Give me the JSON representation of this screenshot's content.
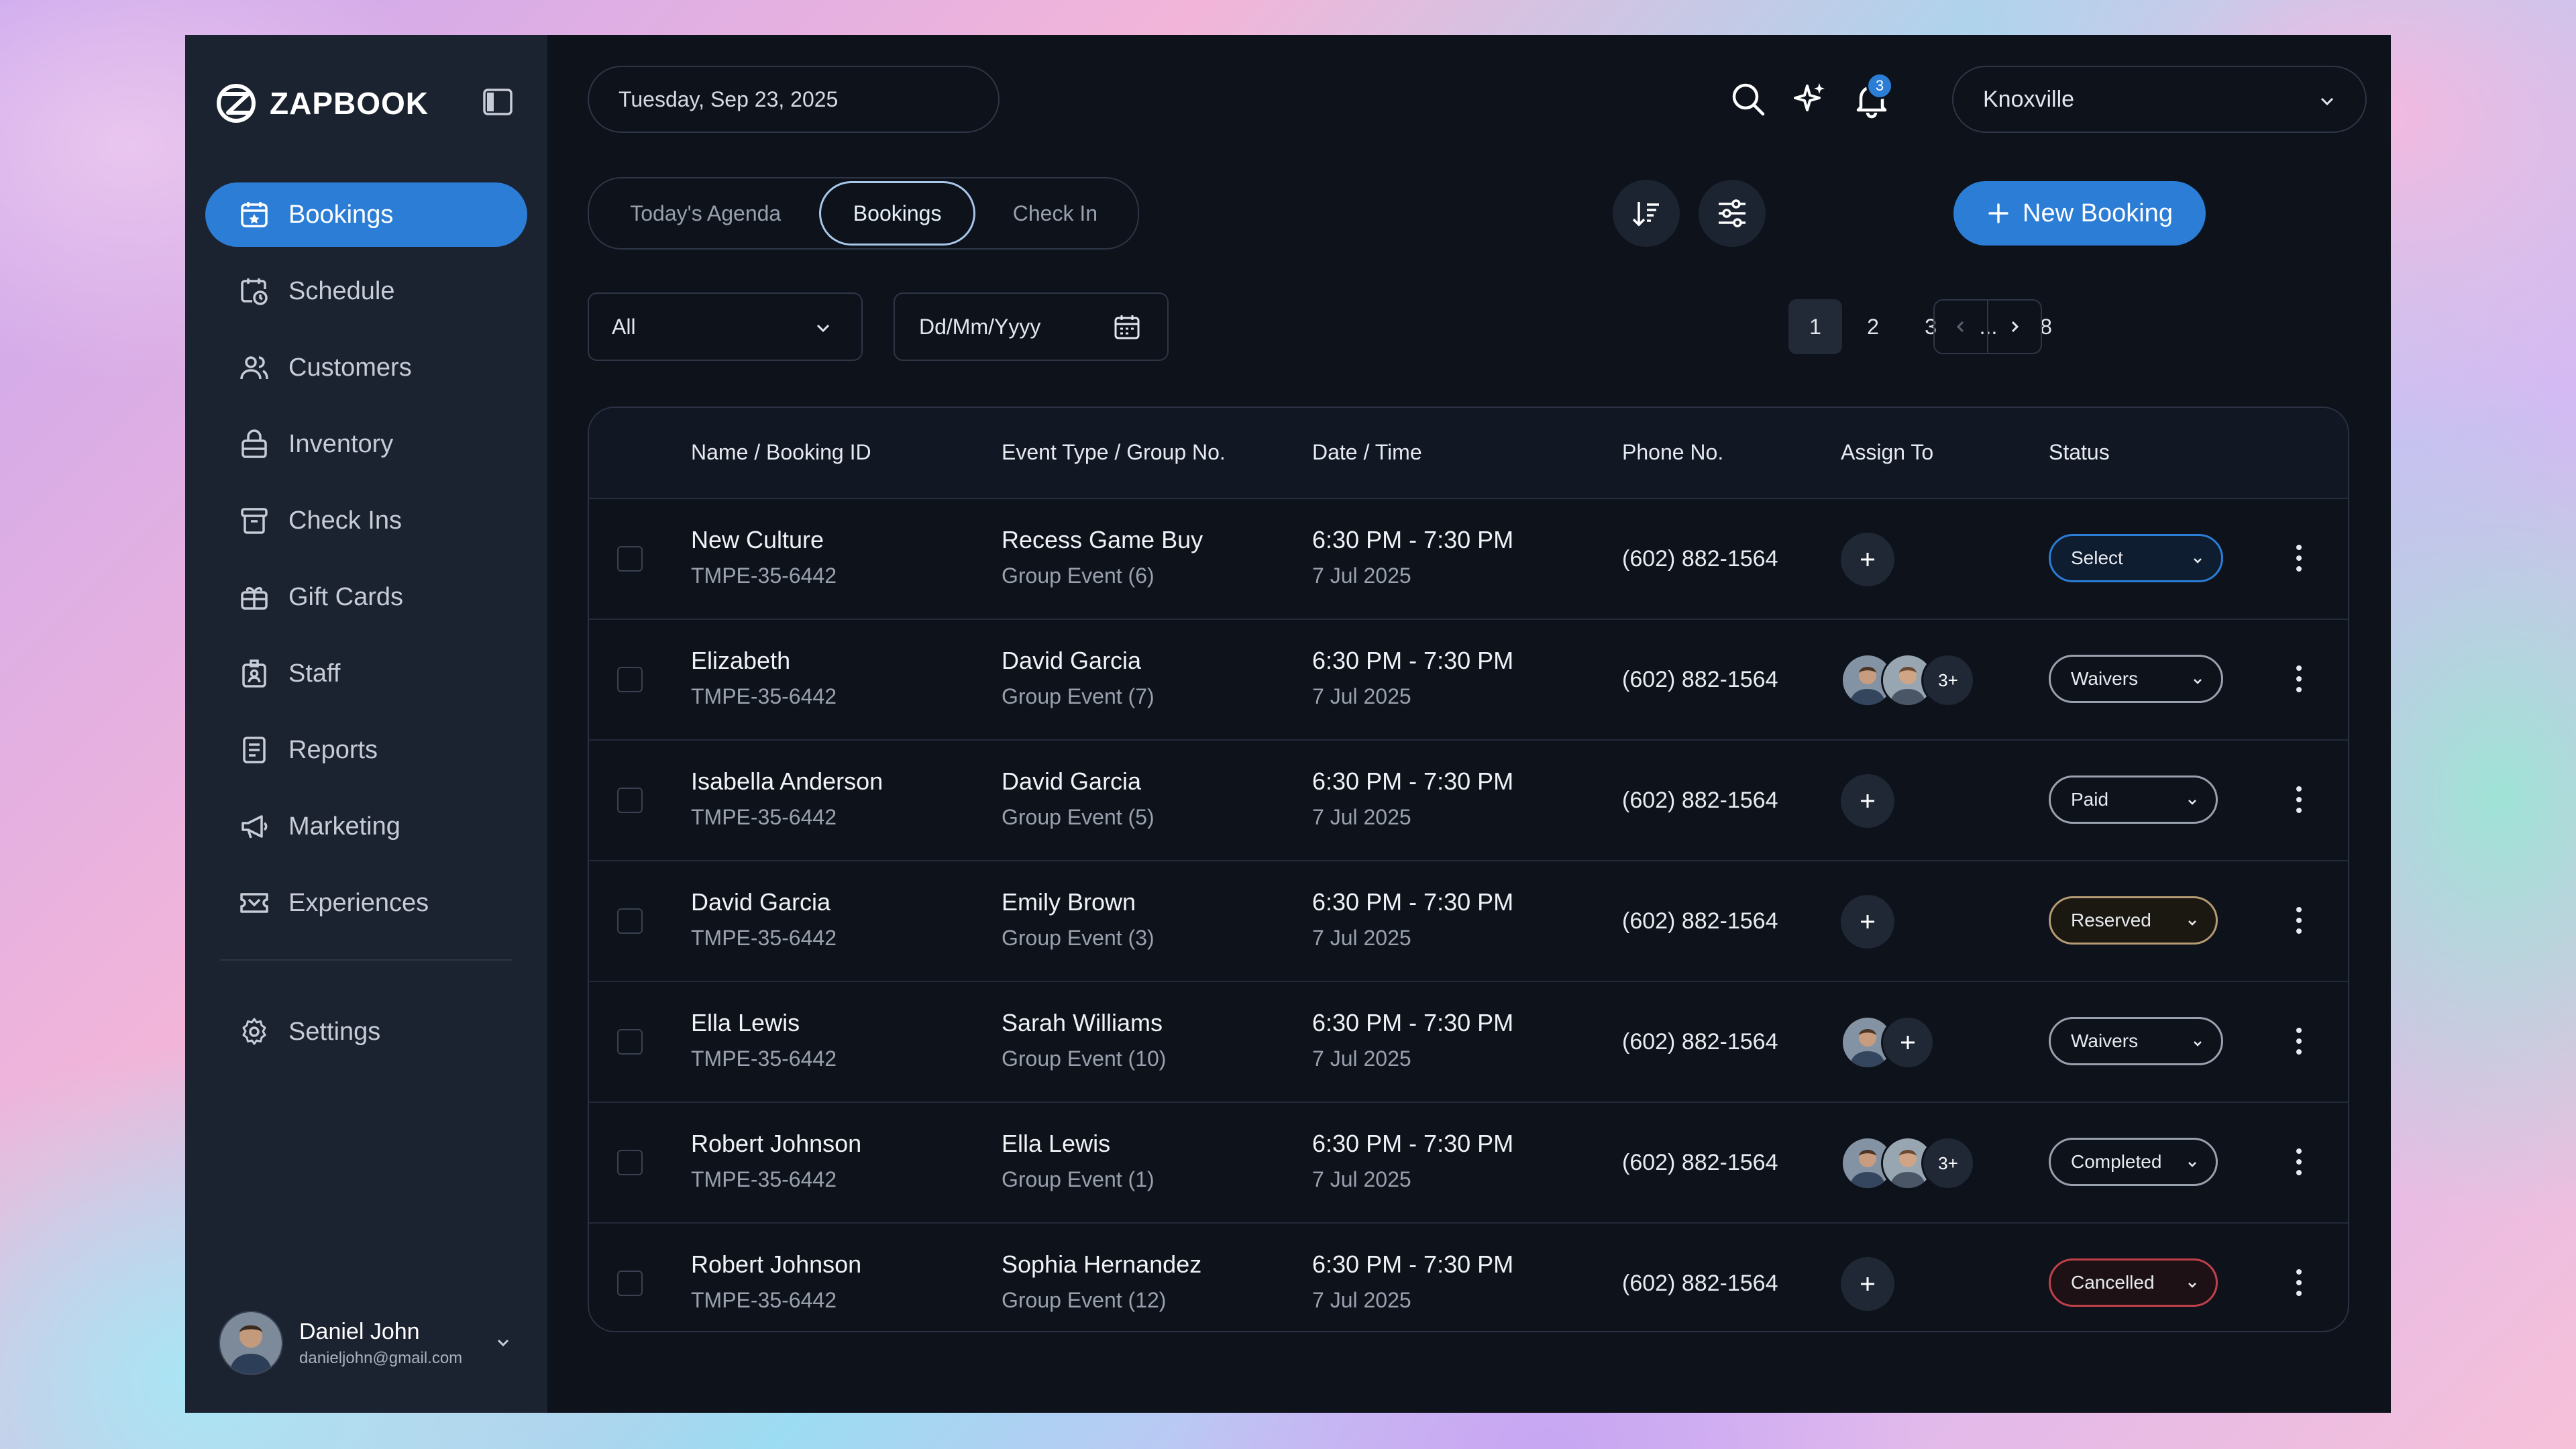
{
  "app": {
    "name": "ZAPBOOK"
  },
  "sidebar": {
    "items": [
      {
        "label": "Bookings",
        "icon": "calendar-star-icon",
        "active": true
      },
      {
        "label": "Schedule",
        "icon": "calendar-clock-icon"
      },
      {
        "label": "Customers",
        "icon": "users-icon"
      },
      {
        "label": "Inventory",
        "icon": "lock-box-icon"
      },
      {
        "label": "Check Ins",
        "icon": "archive-icon"
      },
      {
        "label": "Gift Cards",
        "icon": "gift-icon"
      },
      {
        "label": "Staff",
        "icon": "badge-icon"
      },
      {
        "label": "Reports",
        "icon": "document-icon"
      },
      {
        "label": "Marketing",
        "icon": "megaphone-icon"
      },
      {
        "label": "Experiences",
        "icon": "ticket-icon"
      }
    ],
    "settings_label": "Settings",
    "user": {
      "name": "Daniel John",
      "email": "danieljohn@gmail.com"
    }
  },
  "header": {
    "date": "Tuesday, Sep 23, 2025",
    "notification_count": "3",
    "location": "Knoxville"
  },
  "tabs": [
    {
      "label": "Today's Agenda"
    },
    {
      "label": "Bookings",
      "active": true
    },
    {
      "label": "Check In"
    }
  ],
  "toolbar": {
    "new_booking_label": "New Booking"
  },
  "filters": {
    "type_value": "All",
    "date_placeholder": "Dd/Mm/Yyyy"
  },
  "pagination": {
    "pages": [
      "1",
      "2",
      "3",
      "...",
      "8"
    ],
    "current": "1"
  },
  "table": {
    "headers": [
      "Name / Booking ID",
      "Event Type / Group No.",
      "Date / Time",
      "Phone No.",
      "Assign To",
      "Status"
    ],
    "rows": [
      {
        "name": "New Culture",
        "booking_id": "TMPE-35-6442",
        "event": "Recess Game Buy",
        "group": "Group Event (6)",
        "time": "6:30 PM - 7:30 PM",
        "date": "7 Jul 2025",
        "phone": "(602) 882-1564",
        "status": "Select"
      },
      {
        "name": "Elizabeth",
        "booking_id": "TMPE-35-6442",
        "event": "David Garcia",
        "group": "Group Event (7)",
        "time": "6:30 PM - 7:30 PM",
        "date": "7 Jul 2025",
        "phone": "(602) 882-1564",
        "more": "3+",
        "status": "Waivers"
      },
      {
        "name": "Isabella Anderson",
        "booking_id": "TMPE-35-6442",
        "event": "David Garcia",
        "group": "Group Event (5)",
        "time": "6:30 PM - 7:30 PM",
        "date": "7 Jul 2025",
        "phone": "(602) 882-1564",
        "status": "Paid"
      },
      {
        "name": "David Garcia",
        "booking_id": "TMPE-35-6442",
        "event": "Emily Brown",
        "group": "Group Event (3)",
        "time": "6:30 PM - 7:30 PM",
        "date": "7 Jul 2025",
        "phone": "(602) 882-1564",
        "status": "Reserved"
      },
      {
        "name": "Ella Lewis",
        "booking_id": "TMPE-35-6442",
        "event": "Sarah Williams",
        "group": "Group Event (10)",
        "time": "6:30 PM - 7:30 PM",
        "date": "7 Jul 2025",
        "phone": "(602) 882-1564",
        "status": "Waivers"
      },
      {
        "name": "Robert Johnson",
        "booking_id": "TMPE-35-6442",
        "event": "Ella Lewis",
        "group": "Group Event (1)",
        "time": "6:30 PM - 7:30 PM",
        "date": "7 Jul 2025",
        "phone": "(602) 882-1564",
        "more": "3+",
        "status": "Completed"
      },
      {
        "name": "Robert Johnson",
        "booking_id": "TMPE-35-6442",
        "event": "Sophia Hernandez",
        "group": "Group Event (12)",
        "time": "6:30 PM - 7:30 PM",
        "date": "7 Jul 2025",
        "phone": "(602) 882-1564",
        "status": "Cancelled"
      }
    ]
  },
  "colors": {
    "accent": "#2b7dd6",
    "background": "#0d121b",
    "sidebar": "#1b2230",
    "cancelled": "#c0404a",
    "reserved": "#b59a74",
    "select": "#2b7dd6"
  }
}
